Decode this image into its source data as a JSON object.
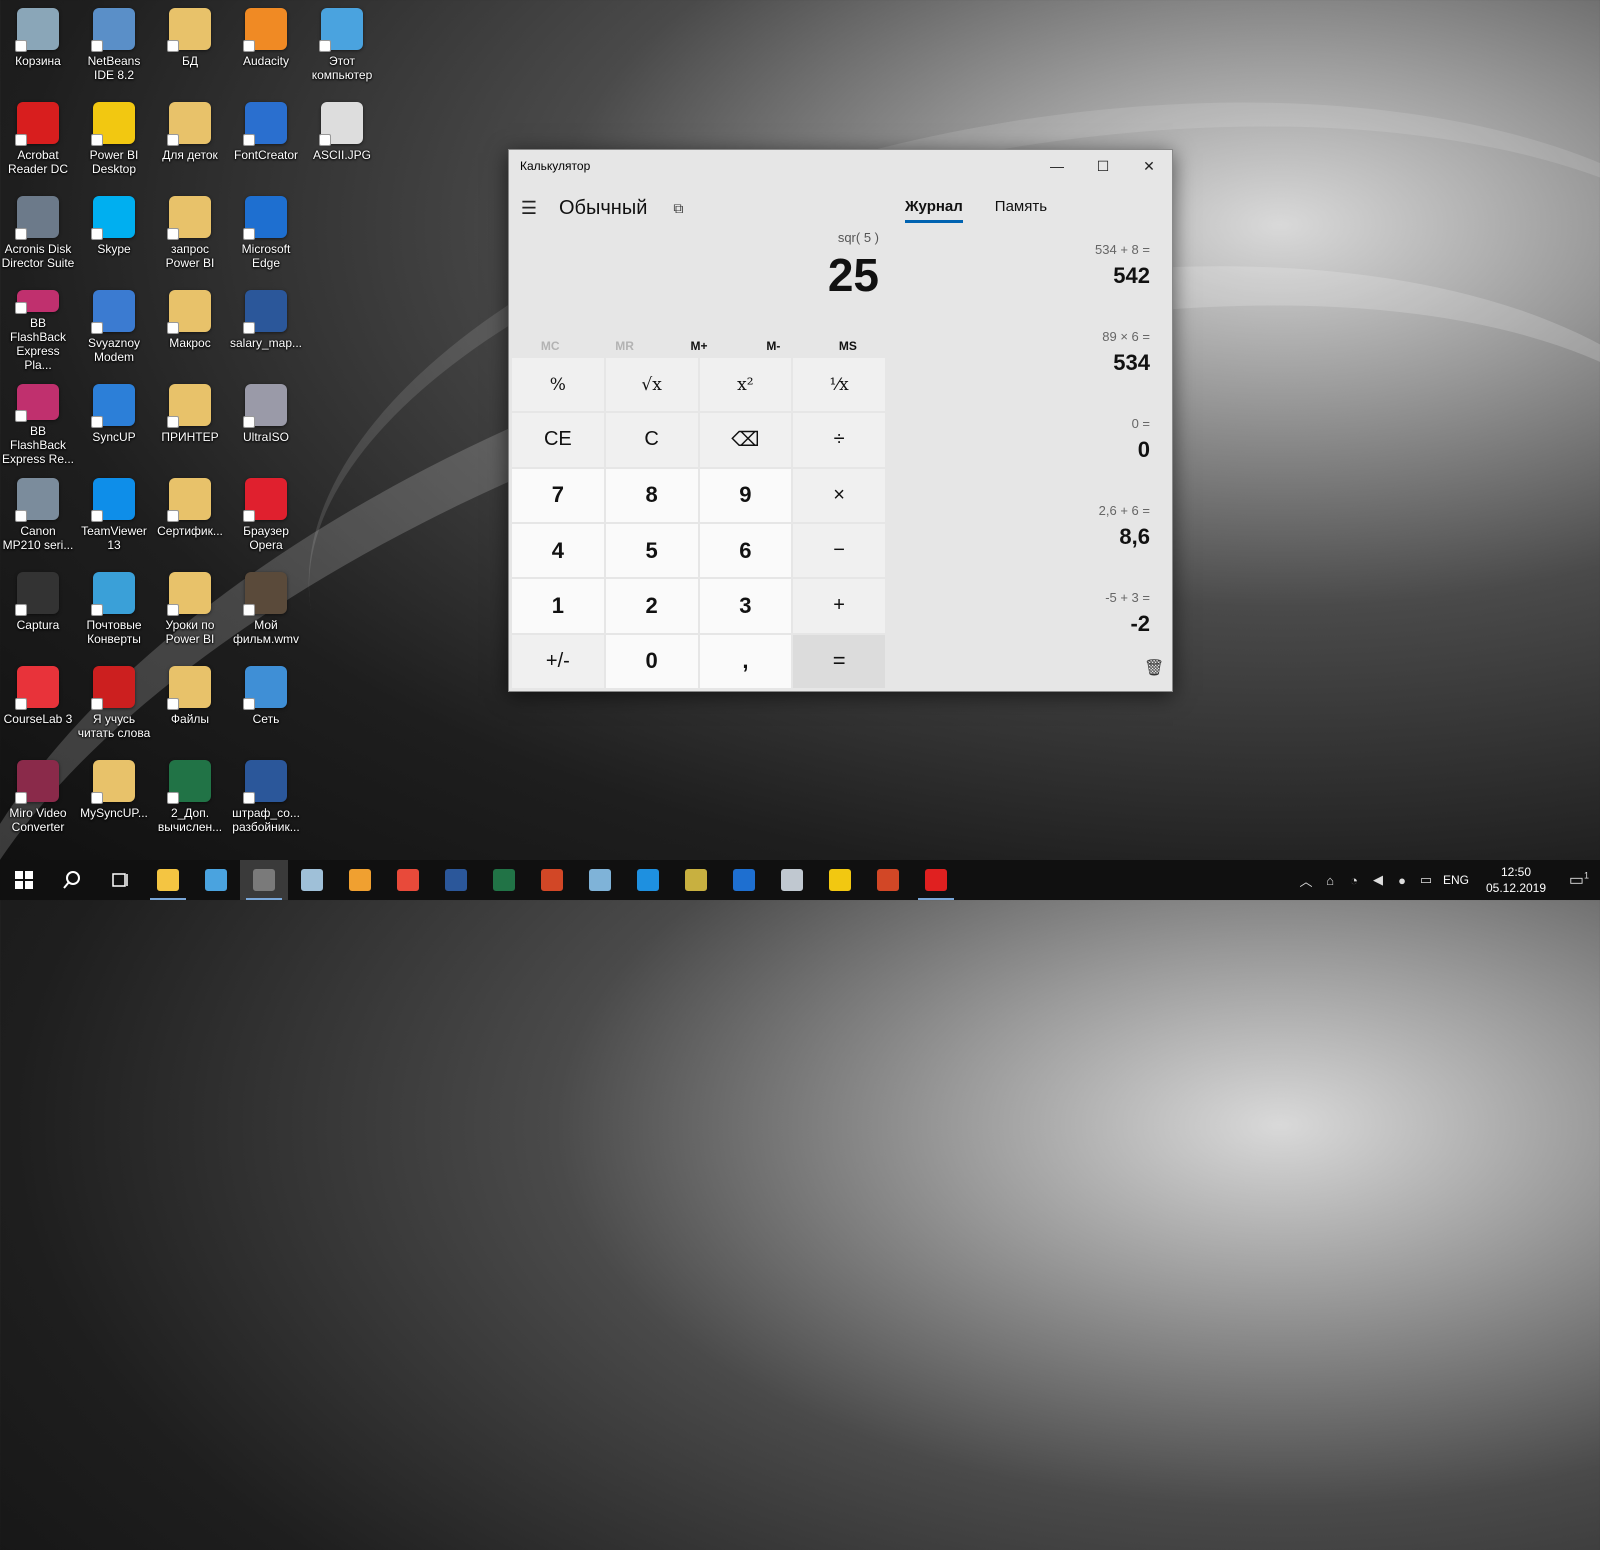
{
  "desktop": {
    "icons": [
      {
        "label": "Корзина",
        "icon": "recycle-bin-icon",
        "color": "#8aa6b8"
      },
      {
        "label": "NetBeans IDE 8.2",
        "icon": "netbeans-icon",
        "color": "#5a8fc8"
      },
      {
        "label": "БД",
        "icon": "folder-icon",
        "color": "#e8c26a"
      },
      {
        "label": "Audacity",
        "icon": "audacity-icon",
        "color": "#f08a24"
      },
      {
        "label": "Этот компьютер",
        "icon": "computer-icon",
        "color": "#4aa3df"
      },
      {
        "label": "Acrobat Reader DC",
        "icon": "acrobat-icon",
        "color": "#d81e1e"
      },
      {
        "label": "Power BI Desktop",
        "icon": "power-bi-icon",
        "color": "#f2c811"
      },
      {
        "label": "Для деток",
        "icon": "folder-icon",
        "color": "#e8c26a"
      },
      {
        "label": "FontCreator",
        "icon": "fontcreator-icon",
        "color": "#2a6fcf"
      },
      {
        "label": "ASCII.JPG",
        "icon": "image-file-icon",
        "color": "#dddddd"
      },
      {
        "label": "Acronis Disk Director Suite",
        "icon": "acronis-icon",
        "color": "#6c7a8a"
      },
      {
        "label": "Skype",
        "icon": "skype-icon",
        "color": "#00aff0"
      },
      {
        "label": "запрос Power BI",
        "icon": "folder-icon",
        "color": "#e8c26a"
      },
      {
        "label": "Microsoft Edge",
        "icon": "edge-icon",
        "color": "#1e6fd0"
      },
      {
        "label": "BB FlashBack Express Pla...",
        "icon": "flashback-player-icon",
        "color": "#c0306e"
      },
      {
        "label": "Svyaznoy Modem",
        "icon": "modem-icon",
        "color": "#3b7bd1"
      },
      {
        "label": "Макрос",
        "icon": "folder-icon",
        "color": "#e8c26a"
      },
      {
        "label": "salary_map...",
        "icon": "word-doc-icon",
        "color": "#2b579a"
      },
      {
        "label": "BB FlashBack Express Re...",
        "icon": "flashback-recorder-icon",
        "color": "#c0306e"
      },
      {
        "label": "SyncUP",
        "icon": "syncup-icon",
        "color": "#2c7fd8"
      },
      {
        "label": "ПРИНТЕР",
        "icon": "folder-icon",
        "color": "#e8c26a"
      },
      {
        "label": "UltraISO",
        "icon": "ultraiso-icon",
        "color": "#9a9aa8"
      },
      {
        "label": "Canon MP210 seri...",
        "icon": "printer-icon",
        "color": "#7b8c9c"
      },
      {
        "label": "TeamViewer 13",
        "icon": "teamviewer-icon",
        "color": "#0e8ee9"
      },
      {
        "label": "Сертифик...",
        "icon": "folder-icon",
        "color": "#e8c26a"
      },
      {
        "label": "Браузер Opera",
        "icon": "opera-icon",
        "color": "#e0202e"
      },
      {
        "label": "Captura",
        "icon": "captura-icon",
        "color": "#333333"
      },
      {
        "label": "Почтовые Конверты",
        "icon": "envelope-icon",
        "color": "#3aa0d8"
      },
      {
        "label": "Уроки по Power BI",
        "icon": "folder-icon",
        "color": "#e8c26a"
      },
      {
        "label": "Мой фильм.wmv",
        "icon": "video-file-icon",
        "color": "#5a4a3a"
      },
      {
        "label": "CourseLab 3",
        "icon": "courselab-icon",
        "color": "#e8333a"
      },
      {
        "label": "Я учусь читать слова",
        "icon": "flash-icon",
        "color": "#cc1f1f"
      },
      {
        "label": "Файлы",
        "icon": "folder-icon",
        "color": "#e8c26a"
      },
      {
        "label": "Сеть",
        "icon": "network-icon",
        "color": "#3f8fd6"
      },
      {
        "label": "Miro Video Converter",
        "icon": "miro-icon",
        "color": "#8a2a4a"
      },
      {
        "label": "MySyncUP...",
        "icon": "folder-icon",
        "color": "#e8c26a"
      },
      {
        "label": "2_Доп. вычислен...",
        "icon": "excel-doc-icon",
        "color": "#217346"
      },
      {
        "label": "штраф_со... разбойник...",
        "icon": "word-doc-icon",
        "color": "#2b579a"
      }
    ]
  },
  "calculator": {
    "window_title": "Калькулятор",
    "minimize": "—",
    "maximize": "☐",
    "close": "✕",
    "menu_icon": "☰",
    "mode": "Обычный",
    "keep_on_top_icon": "⧉",
    "expression": "sqr( 5 )",
    "display": "25",
    "memory": [
      {
        "label": "MC",
        "disabled": true
      },
      {
        "label": "MR",
        "disabled": true
      },
      {
        "label": "M+",
        "disabled": false
      },
      {
        "label": "M-",
        "disabled": false
      },
      {
        "label": "MS",
        "disabled": false
      }
    ],
    "keys": [
      {
        "label": "%",
        "type": "fn",
        "name": "percent-key"
      },
      {
        "label": "√x",
        "type": "fn",
        "name": "sqrt-key"
      },
      {
        "label": "x²",
        "type": "fn",
        "name": "square-key"
      },
      {
        "label": "¹⁄x",
        "type": "fn",
        "name": "reciprocal-key"
      },
      {
        "label": "CE",
        "type": "op",
        "name": "clear-entry-key"
      },
      {
        "label": "C",
        "type": "op",
        "name": "clear-key"
      },
      {
        "label": "⌫",
        "type": "op",
        "name": "backspace-key"
      },
      {
        "label": "÷",
        "type": "op",
        "name": "divide-key"
      },
      {
        "label": "7",
        "type": "num",
        "name": "digit-7-key"
      },
      {
        "label": "8",
        "type": "num",
        "name": "digit-8-key"
      },
      {
        "label": "9",
        "type": "num",
        "name": "digit-9-key"
      },
      {
        "label": "×",
        "type": "op",
        "name": "multiply-key"
      },
      {
        "label": "4",
        "type": "num",
        "name": "digit-4-key"
      },
      {
        "label": "5",
        "type": "num",
        "name": "digit-5-key"
      },
      {
        "label": "6",
        "type": "num",
        "name": "digit-6-key"
      },
      {
        "label": "−",
        "type": "op",
        "name": "subtract-key"
      },
      {
        "label": "1",
        "type": "num",
        "name": "digit-1-key"
      },
      {
        "label": "2",
        "type": "num",
        "name": "digit-2-key"
      },
      {
        "label": "3",
        "type": "num",
        "name": "digit-3-key"
      },
      {
        "label": "+",
        "type": "op",
        "name": "add-key"
      },
      {
        "label": "+/-",
        "type": "op",
        "name": "negate-key"
      },
      {
        "label": "0",
        "type": "num",
        "name": "digit-0-key"
      },
      {
        "label": ",",
        "type": "num",
        "name": "decimal-key"
      },
      {
        "label": "=",
        "type": "eq",
        "name": "equals-key"
      }
    ],
    "tabs": [
      {
        "label": "Журнал",
        "active": true
      },
      {
        "label": "Память",
        "active": false
      }
    ],
    "history": [
      {
        "expr": "534  +  8 =",
        "result": "542"
      },
      {
        "expr": "89  ×  6 =",
        "result": "534"
      },
      {
        "expr": "0 =",
        "result": "0"
      },
      {
        "expr": "2,6  +  6 =",
        "result": "8,6"
      },
      {
        "expr": "-5  +  3 =",
        "result": "-2"
      }
    ],
    "trash_icon": "🗑"
  },
  "taskbar": {
    "apps": [
      {
        "icon": "file-explorer-icon",
        "color": "#f4c542",
        "running": true,
        "active": false
      },
      {
        "icon": "control-panel-icon",
        "color": "#4aa3df",
        "running": false,
        "active": false
      },
      {
        "icon": "calculator-icon",
        "color": "#7a7a7a",
        "running": true,
        "active": true
      },
      {
        "icon": "tool-icon",
        "color": "#9fc0d8",
        "running": false,
        "active": false
      },
      {
        "icon": "media-player-icon",
        "color": "#f0a030",
        "running": false,
        "active": false
      },
      {
        "icon": "chrome-icon",
        "color": "#e84a3a",
        "running": false,
        "active": false
      },
      {
        "icon": "word-icon",
        "color": "#2b579a",
        "running": false,
        "active": false
      },
      {
        "icon": "excel-icon",
        "color": "#217346",
        "running": false,
        "active": false
      },
      {
        "icon": "powerpoint-icon",
        "color": "#d24726",
        "running": false,
        "active": false
      },
      {
        "icon": "notebook-icon",
        "color": "#7fb3d8",
        "running": false,
        "active": false
      },
      {
        "icon": "internet-explorer-icon",
        "color": "#1e90e0",
        "running": false,
        "active": false
      },
      {
        "icon": "archiver-icon",
        "color": "#c8b040",
        "running": false,
        "active": false
      },
      {
        "icon": "edge-icon",
        "color": "#1e6fd0",
        "running": false,
        "active": false
      },
      {
        "icon": "paint-icon",
        "color": "#c0c8d0",
        "running": false,
        "active": false
      },
      {
        "icon": "power-bi-icon",
        "color": "#f2c811",
        "running": false,
        "active": false
      },
      {
        "icon": "powerpoint-icon",
        "color": "#d24726",
        "running": false,
        "active": false
      },
      {
        "icon": "recorder-icon",
        "color": "#e02020",
        "running": true,
        "active": false
      }
    ],
    "tray": {
      "language": "ENG",
      "time": "12:50",
      "date": "05.12.2019",
      "notifications": "1"
    }
  }
}
